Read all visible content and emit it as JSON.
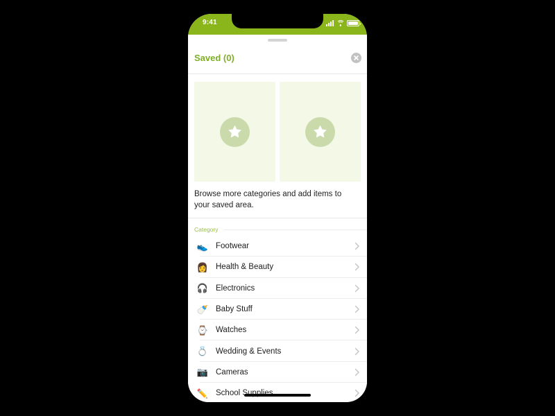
{
  "theme": {
    "brand_green": "#8ab61c",
    "title_green": "#7fae26",
    "section_label_green": "#9ac24a",
    "card_bg": "#f3f8e7",
    "star_circle": "#cbdaab",
    "phone_bg": "#ffffff",
    "backdrop": "#000000"
  },
  "status_bar": {
    "time": "9:41",
    "icons": [
      "cellular-signal-icon",
      "wifi-icon",
      "battery-icon"
    ]
  },
  "sheet": {
    "grabber": "drag-handle",
    "title": "Saved (0)",
    "close_label": "×"
  },
  "saved": {
    "placeholders": [
      {
        "icon": "star-icon"
      },
      {
        "icon": "star-icon"
      }
    ],
    "empty_message": "Browse more categories and add items to your saved area."
  },
  "category_section": {
    "label": "Category",
    "items": [
      {
        "emoji": "👟",
        "icon": "shoe-icon",
        "label": "Footwear"
      },
      {
        "emoji": "👩",
        "icon": "person-icon",
        "label": "Health & Beauty"
      },
      {
        "emoji": "🎧",
        "icon": "headphones-icon",
        "label": "Electronics"
      },
      {
        "emoji": "🍼",
        "icon": "baby-bottle-icon",
        "label": "Baby Stuff"
      },
      {
        "emoji": "⌚",
        "icon": "watch-icon",
        "label": "Watches"
      },
      {
        "emoji": "💍",
        "icon": "ring-icon",
        "label": "Wedding & Events"
      },
      {
        "emoji": "📷",
        "icon": "camera-icon",
        "label": "Cameras"
      },
      {
        "emoji": "✏️",
        "icon": "pencil-icon",
        "label": "School Supplies"
      }
    ]
  },
  "home_indicator": "home-indicator-bar"
}
